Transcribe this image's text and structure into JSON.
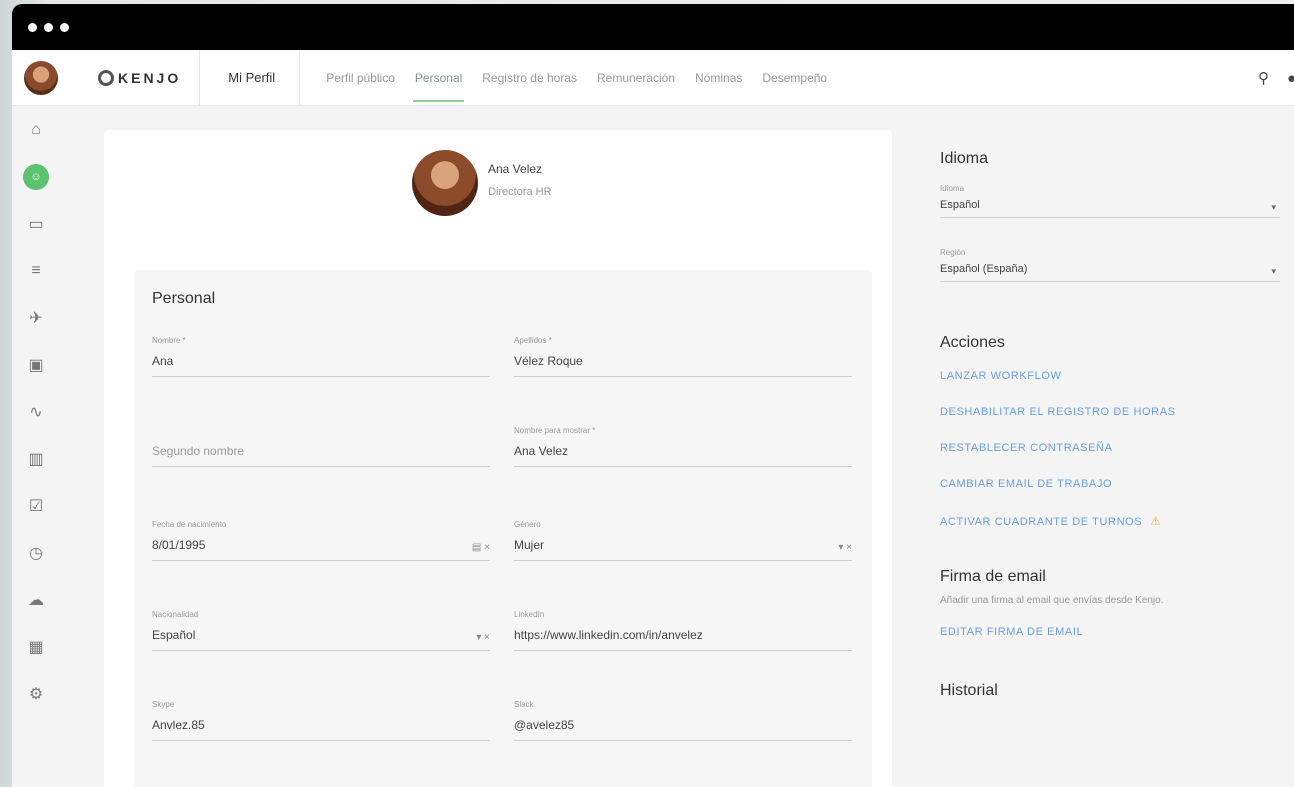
{
  "window": {
    "dots": 3
  },
  "topnav": {
    "logo_text": "KENJO",
    "my_profile": "Mi Perfil",
    "tabs": [
      {
        "label": "Perfil público",
        "active": false
      },
      {
        "label": "Personal",
        "active": true
      },
      {
        "label": "Registro de horas",
        "active": false
      },
      {
        "label": "Remuneración",
        "active": false
      },
      {
        "label": "Nóminas",
        "active": false
      },
      {
        "label": "Desempeño",
        "active": false
      }
    ],
    "icons": [
      "search-icon",
      "notification-icon"
    ]
  },
  "sidebar": {
    "items": [
      {
        "icon": "home-icon",
        "glyph": "⌂",
        "active": false
      },
      {
        "icon": "people-icon",
        "glyph": "☺",
        "active": true
      },
      {
        "icon": "folder-icon",
        "glyph": "▭",
        "active": false
      },
      {
        "icon": "list-icon",
        "glyph": "≡",
        "active": false
      },
      {
        "icon": "plane-icon",
        "glyph": "✈",
        "active": false
      },
      {
        "icon": "calendar-icon",
        "glyph": "▣",
        "active": false
      },
      {
        "icon": "activity-icon",
        "glyph": "∿",
        "active": false
      },
      {
        "icon": "chart-icon",
        "glyph": "▥",
        "active": false
      },
      {
        "icon": "task-icon",
        "glyph": "☑",
        "active": false
      },
      {
        "icon": "clock-icon",
        "glyph": "◷",
        "active": false
      },
      {
        "icon": "cloud-icon",
        "glyph": "☁",
        "active": false
      },
      {
        "icon": "grid-icon",
        "glyph": "▦",
        "active": false
      },
      {
        "icon": "settings-icon",
        "glyph": "⚙",
        "active": false
      }
    ]
  },
  "profile": {
    "name": "Ana Velez",
    "role": "Directora HR"
  },
  "personal": {
    "title": "Personal",
    "fields": {
      "nombre": {
        "label": "Nombre *",
        "value": "Ana"
      },
      "apellidos": {
        "label": "Apellidos *",
        "value": "Vélez Roque"
      },
      "segundo_nombre": {
        "label": "",
        "value": "Segundo nombre"
      },
      "nombre_display": {
        "label": "Nombre para mostrar *",
        "value": "Ana Velez"
      },
      "nacimiento": {
        "label": "Fecha de nacimiento",
        "value": "8/01/1995"
      },
      "genero": {
        "label": "Género",
        "value": "Mujer"
      },
      "nacionalidad": {
        "label": "Nacionalidad",
        "value": "Español"
      },
      "linkedin": {
        "label": "LinkedIn",
        "value": "https://www.linkedin.com/in/anvelez"
      },
      "skype": {
        "label": "Skype",
        "value": "Anvlez.85"
      },
      "slack": {
        "label": "Slack",
        "value": "@avelez85"
      }
    }
  },
  "right": {
    "idioma_title": "Idioma",
    "idioma_field": {
      "label": "Idioma",
      "value": "Español"
    },
    "region_field": {
      "label": "Región",
      "value": "Español (España)"
    },
    "acciones_title": "Acciones",
    "actions": {
      "launch": "LANZAR WORKFLOW",
      "disable_hours": "DESHABILITAR EL REGISTRO DE HORAS",
      "reset_password": "RESTABLECER CONTRASEÑA",
      "change_email": "CAMBIAR EMAIL DE TRABAJO",
      "activate_shifts": "ACTIVAR CUADRANTE DE TURNOS"
    },
    "firma_title": "Firma de email",
    "firma_text": "Añadir una firma al email que envías desde Kenjo.",
    "firma_action": "EDITAR FIRMA DE EMAIL",
    "historial_title": "Historial"
  }
}
